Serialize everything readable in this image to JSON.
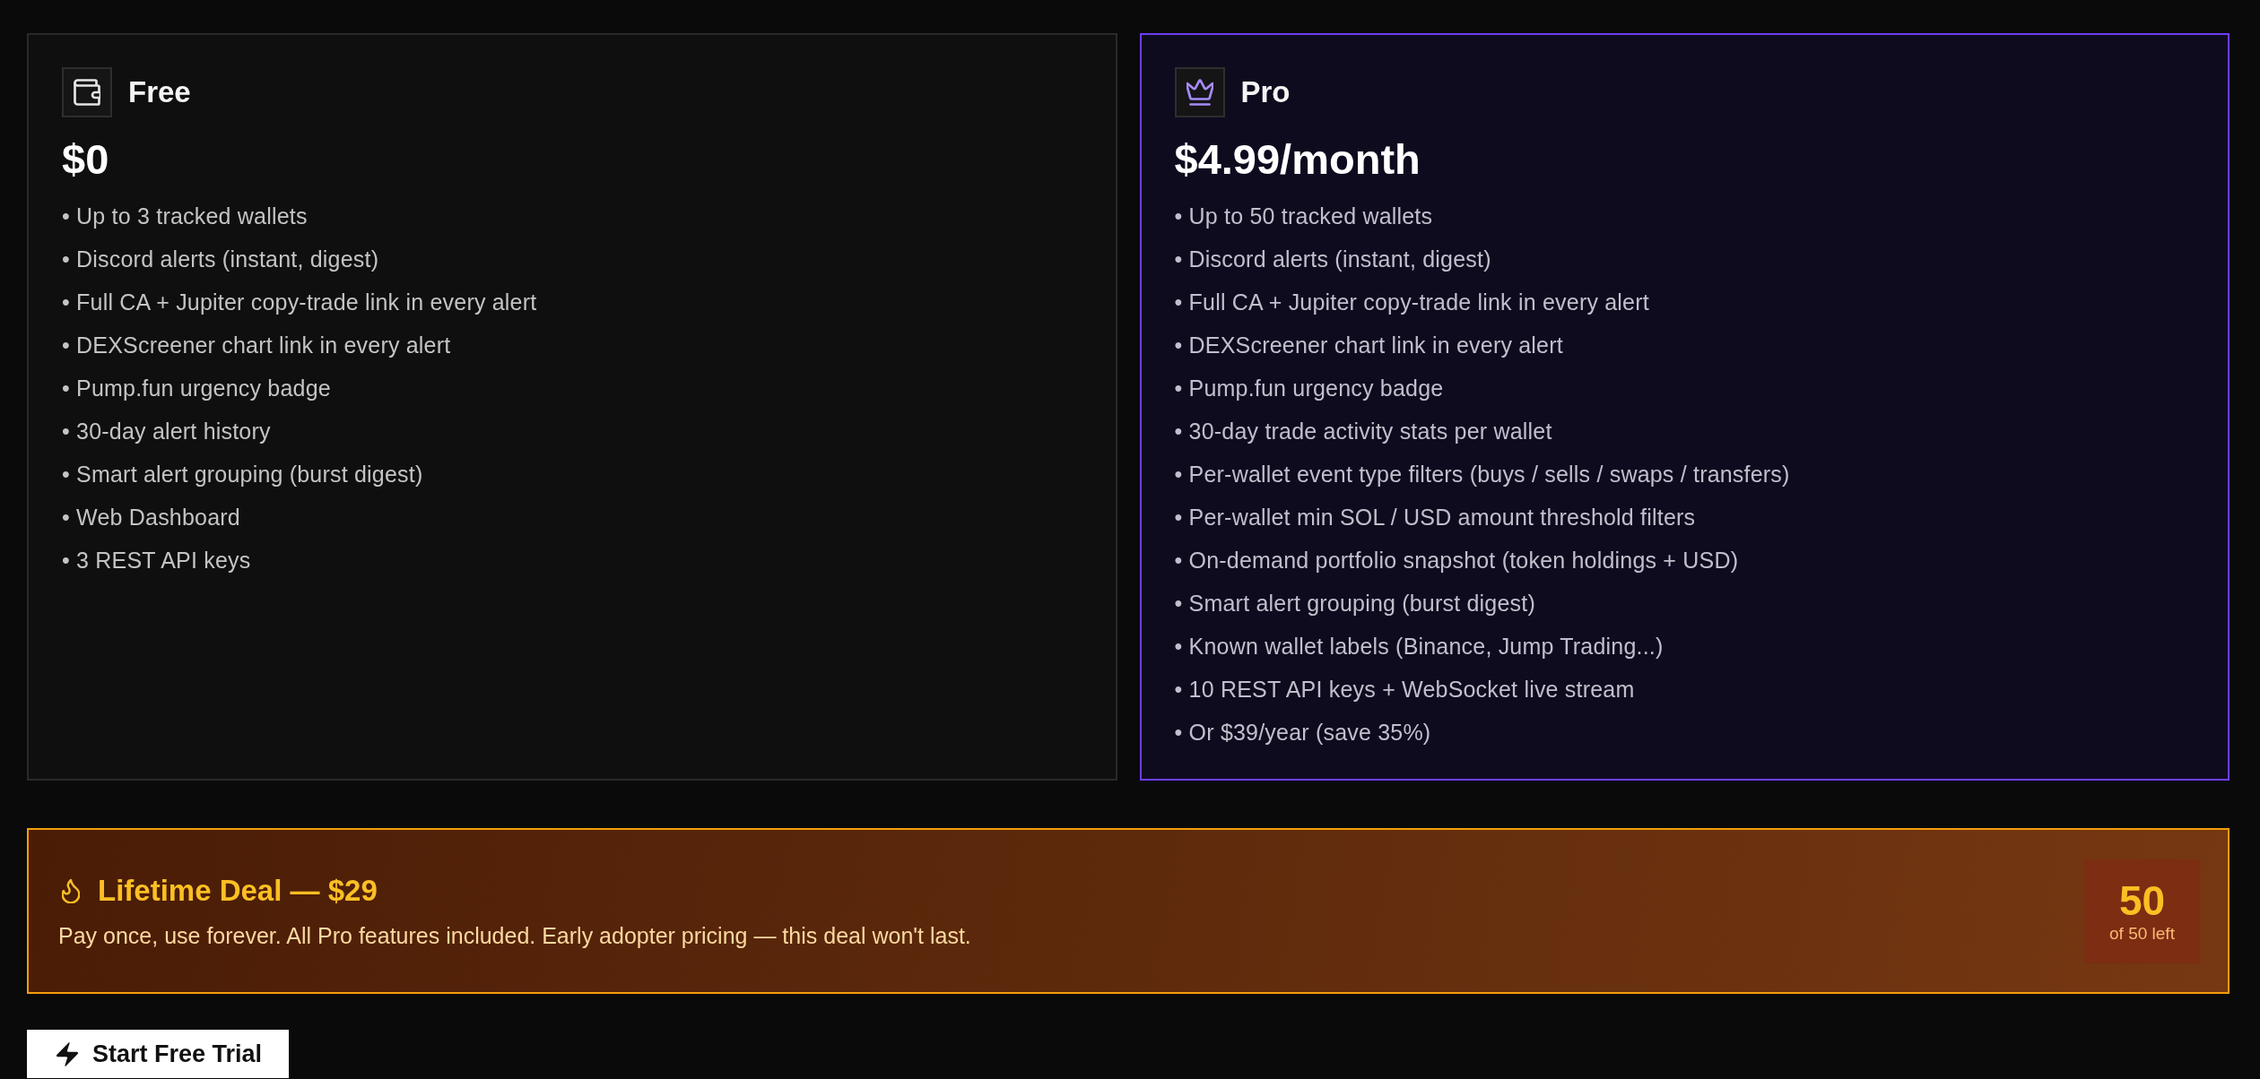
{
  "plans": [
    {
      "kind": "free",
      "featured": false,
      "name": "Free",
      "price": "$0",
      "features": [
        "• Up to 3 tracked wallets",
        "• Discord alerts (instant, digest)",
        "• Full CA + Jupiter copy-trade link in every alert",
        "• DEXScreener chart link in every alert",
        "• Pump.fun urgency badge",
        "• 30-day alert history",
        "• Smart alert grouping (burst digest)",
        "• Web Dashboard",
        "• 3 REST API keys"
      ]
    },
    {
      "kind": "pro",
      "featured": true,
      "name": "Pro",
      "price": "$4.99/month",
      "features": [
        "• Up to 50 tracked wallets",
        "• Discord alerts (instant, digest)",
        "• Full CA + Jupiter copy-trade link in every alert",
        "• DEXScreener chart link in every alert",
        "• Pump.fun urgency badge",
        "• 30-day trade activity stats per wallet",
        "• Per-wallet event type filters (buys / sells / swaps / transfers)",
        "• Per-wallet min SOL / USD amount threshold filters",
        "• On-demand portfolio snapshot (token holdings + USD)",
        "• Smart alert grouping (burst digest)",
        "• Known wallet labels (Binance, Jump Trading...)",
        "• 10 REST API keys + WebSocket live stream",
        "• Or $39/year (save 35%)"
      ]
    }
  ],
  "lifetime_deal": {
    "title": "Lifetime Deal — $29",
    "description": "Pay once, use forever. All Pro features included. Early adopter pricing — this deal won't last.",
    "remaining": {
      "count": "50",
      "caption": "of 50 left"
    }
  },
  "cta_button": {
    "label": "Start Free Trial"
  }
}
